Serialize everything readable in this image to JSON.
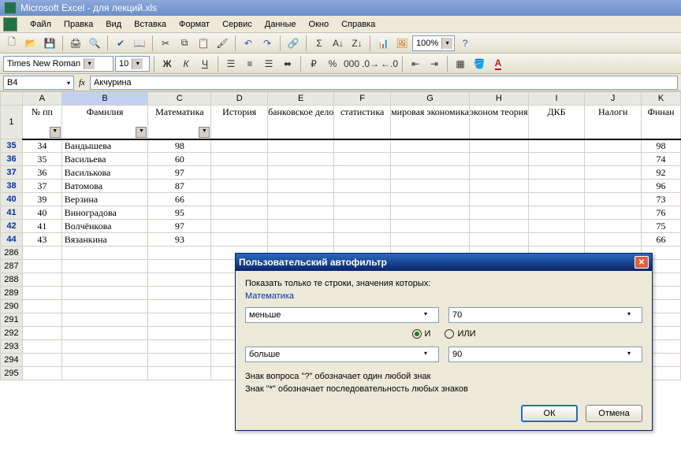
{
  "titlebar": {
    "title": "Microsoft Excel - для лекций.xls"
  },
  "menu": {
    "file": "Файл",
    "edit": "Правка",
    "view": "Вид",
    "insert": "Вставка",
    "format": "Формат",
    "tools": "Сервис",
    "data": "Данные",
    "window": "Окно",
    "help": "Справка"
  },
  "toolbar2": {
    "font": "Times New Roman",
    "size": "10",
    "zoom": "100%"
  },
  "namebox": {
    "ref": "B4"
  },
  "formulabar": {
    "value": "Акчурина"
  },
  "columns": [
    "A",
    "B",
    "C",
    "D",
    "E",
    "F",
    "G",
    "H",
    "I",
    "J",
    "K"
  ],
  "headers": {
    "A": "№ пп",
    "B": "Фамилия",
    "C": "Математика",
    "D": "История",
    "E": "банковское дело",
    "F": "статистика",
    "G": "мировая экономика",
    "H": "эконом теория",
    "I": "ДКБ",
    "J": "Налоги",
    "K": "Финан"
  },
  "filter_row_labels": [
    "35",
    "36",
    "37",
    "38",
    "40",
    "41",
    "42",
    "44"
  ],
  "rows": [
    {
      "r": "35",
      "A": "34",
      "B": "Вандышева",
      "C": "98",
      "K": "98"
    },
    {
      "r": "36",
      "A": "35",
      "B": "Васильева",
      "C": "60",
      "K": "74"
    },
    {
      "r": "37",
      "A": "36",
      "B": "Василькова",
      "C": "97",
      "K": "92"
    },
    {
      "r": "38",
      "A": "37",
      "B": "Ватомова",
      "C": "87",
      "K": "96"
    },
    {
      "r": "40",
      "A": "39",
      "B": "Верзина",
      "C": "66",
      "K": "73"
    },
    {
      "r": "41",
      "A": "40",
      "B": "Виноградова",
      "C": "95",
      "K": "76"
    },
    {
      "r": "42",
      "A": "41",
      "B": "Волчёнкова",
      "C": "97",
      "K": "75"
    },
    {
      "r": "44",
      "A": "43",
      "B": "Вязанкина",
      "C": "93",
      "K": "66"
    }
  ],
  "empty_rows": [
    "286",
    "287",
    "288",
    "289",
    "290",
    "291",
    "292",
    "293",
    "294",
    "295"
  ],
  "dialog": {
    "title": "Пользовательский автофильтр",
    "subtitle": "Показать только те строки, значения которых:",
    "field": "Математика",
    "op1": "меньше",
    "val1": "70",
    "and": "И",
    "or": "ИЛИ",
    "op2": "больше",
    "val2": "90",
    "hint1": "Знак вопроса \"?\" обозначает один любой знак",
    "hint2": "Знак \"*\" обозначает последовательность любых знаков",
    "ok": "ОК",
    "cancel": "Отмена"
  }
}
